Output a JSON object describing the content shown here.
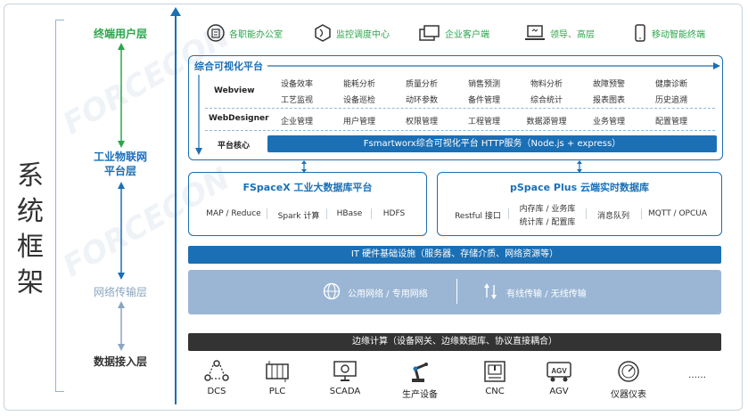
{
  "title": "系统框架",
  "layers": {
    "user": "终端用户层",
    "iot_line1": "工业物联网",
    "iot_line2": "平台层",
    "network": "网络传输层",
    "access": "数据接入层"
  },
  "user_items": [
    {
      "label": "各职能办公室",
      "icon": "building-icon"
    },
    {
      "label": "监控调度中心",
      "icon": "shield-hex-icon"
    },
    {
      "label": "企业客户端",
      "icon": "windows-icon"
    },
    {
      "label": "领导、高层",
      "icon": "laptop-icon"
    },
    {
      "label": "移动智能终端",
      "icon": "phone-icon"
    }
  ],
  "platform": {
    "title": "综合可视化平台",
    "webview_label": "Webview",
    "webview_top": [
      "设备效率",
      "能耗分析",
      "质量分析",
      "销售预测",
      "物料分析",
      "故障预警",
      "健康诊断"
    ],
    "webview_bottom": [
      "工艺监视",
      "设备巡检",
      "动环参数",
      "备件管理",
      "综合统计",
      "报表图表",
      "历史追溯"
    ],
    "designer_label": "WebDesigner",
    "designer_items": [
      "企业管理",
      "用户管理",
      "权限管理",
      "工程管理",
      "数据源管理",
      "业务管理",
      "配置管理"
    ],
    "core_label": "平台核心",
    "core_bar": "Fsmartworx综合可视化平台 HTTP服务（Node.js + express）"
  },
  "db_left": {
    "title": "FSpaceX 工业大数据库平台",
    "items": [
      "MAP / Reduce",
      "Spark 计算",
      "HBase",
      "HDFS"
    ]
  },
  "db_right": {
    "title": "pSpace Plus 云端实时数据库",
    "items": [
      "Restful 接口",
      "内存库 / 业务库",
      "统计库 / 配置库",
      "消息队列",
      "MQTT / OPCUA"
    ]
  },
  "it_bar": "IT 硬件基础设施（服务器、存储介质、网络资源等）",
  "network": {
    "left": "公用网络 / 专用网络",
    "right": "有线传输 / 无线传输"
  },
  "edge_bar": "边缘计算（设备网关、边缘数据库、协议直接耦合）",
  "devices": [
    {
      "label": "DCS",
      "icon": "dcs-icon"
    },
    {
      "label": "PLC",
      "icon": "plc-icon"
    },
    {
      "label": "SCADA",
      "icon": "scada-icon"
    },
    {
      "label": "生产设备",
      "icon": "robot-arm-icon"
    },
    {
      "label": "CNC",
      "icon": "cnc-icon"
    },
    {
      "label": "AGV",
      "icon": "agv-icon"
    },
    {
      "label": "仪器仪表",
      "icon": "gauge-icon"
    },
    {
      "label": "……",
      "icon": ""
    }
  ],
  "colors": {
    "primary": "#1a6fb5",
    "green": "#2aa64a",
    "network": "#9ab6d4",
    "edge": "#333333"
  }
}
